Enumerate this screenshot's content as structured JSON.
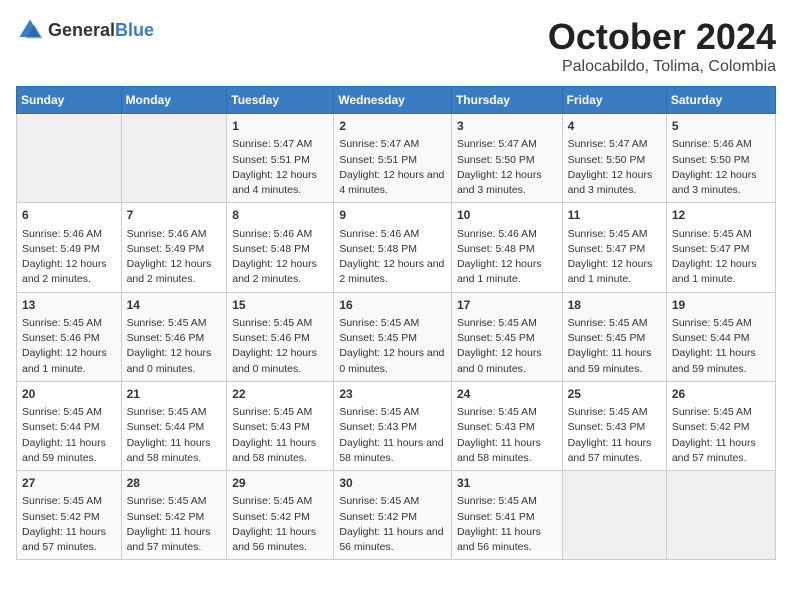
{
  "logo": {
    "text_general": "General",
    "text_blue": "Blue"
  },
  "title": "October 2024",
  "subtitle": "Palocabildo, Tolima, Colombia",
  "days_header": [
    "Sunday",
    "Monday",
    "Tuesday",
    "Wednesday",
    "Thursday",
    "Friday",
    "Saturday"
  ],
  "weeks": [
    [
      {
        "day": "",
        "info": ""
      },
      {
        "day": "",
        "info": ""
      },
      {
        "day": "1",
        "info": "Sunrise: 5:47 AM\nSunset: 5:51 PM\nDaylight: 12 hours and 4 minutes."
      },
      {
        "day": "2",
        "info": "Sunrise: 5:47 AM\nSunset: 5:51 PM\nDaylight: 12 hours and 4 minutes."
      },
      {
        "day": "3",
        "info": "Sunrise: 5:47 AM\nSunset: 5:50 PM\nDaylight: 12 hours and 3 minutes."
      },
      {
        "day": "4",
        "info": "Sunrise: 5:47 AM\nSunset: 5:50 PM\nDaylight: 12 hours and 3 minutes."
      },
      {
        "day": "5",
        "info": "Sunrise: 5:46 AM\nSunset: 5:50 PM\nDaylight: 12 hours and 3 minutes."
      }
    ],
    [
      {
        "day": "6",
        "info": "Sunrise: 5:46 AM\nSunset: 5:49 PM\nDaylight: 12 hours and 2 minutes."
      },
      {
        "day": "7",
        "info": "Sunrise: 5:46 AM\nSunset: 5:49 PM\nDaylight: 12 hours and 2 minutes."
      },
      {
        "day": "8",
        "info": "Sunrise: 5:46 AM\nSunset: 5:48 PM\nDaylight: 12 hours and 2 minutes."
      },
      {
        "day": "9",
        "info": "Sunrise: 5:46 AM\nSunset: 5:48 PM\nDaylight: 12 hours and 2 minutes."
      },
      {
        "day": "10",
        "info": "Sunrise: 5:46 AM\nSunset: 5:48 PM\nDaylight: 12 hours and 1 minute."
      },
      {
        "day": "11",
        "info": "Sunrise: 5:45 AM\nSunset: 5:47 PM\nDaylight: 12 hours and 1 minute."
      },
      {
        "day": "12",
        "info": "Sunrise: 5:45 AM\nSunset: 5:47 PM\nDaylight: 12 hours and 1 minute."
      }
    ],
    [
      {
        "day": "13",
        "info": "Sunrise: 5:45 AM\nSunset: 5:46 PM\nDaylight: 12 hours and 1 minute."
      },
      {
        "day": "14",
        "info": "Sunrise: 5:45 AM\nSunset: 5:46 PM\nDaylight: 12 hours and 0 minutes."
      },
      {
        "day": "15",
        "info": "Sunrise: 5:45 AM\nSunset: 5:46 PM\nDaylight: 12 hours and 0 minutes."
      },
      {
        "day": "16",
        "info": "Sunrise: 5:45 AM\nSunset: 5:45 PM\nDaylight: 12 hours and 0 minutes."
      },
      {
        "day": "17",
        "info": "Sunrise: 5:45 AM\nSunset: 5:45 PM\nDaylight: 12 hours and 0 minutes."
      },
      {
        "day": "18",
        "info": "Sunrise: 5:45 AM\nSunset: 5:45 PM\nDaylight: 11 hours and 59 minutes."
      },
      {
        "day": "19",
        "info": "Sunrise: 5:45 AM\nSunset: 5:44 PM\nDaylight: 11 hours and 59 minutes."
      }
    ],
    [
      {
        "day": "20",
        "info": "Sunrise: 5:45 AM\nSunset: 5:44 PM\nDaylight: 11 hours and 59 minutes."
      },
      {
        "day": "21",
        "info": "Sunrise: 5:45 AM\nSunset: 5:44 PM\nDaylight: 11 hours and 58 minutes."
      },
      {
        "day": "22",
        "info": "Sunrise: 5:45 AM\nSunset: 5:43 PM\nDaylight: 11 hours and 58 minutes."
      },
      {
        "day": "23",
        "info": "Sunrise: 5:45 AM\nSunset: 5:43 PM\nDaylight: 11 hours and 58 minutes."
      },
      {
        "day": "24",
        "info": "Sunrise: 5:45 AM\nSunset: 5:43 PM\nDaylight: 11 hours and 58 minutes."
      },
      {
        "day": "25",
        "info": "Sunrise: 5:45 AM\nSunset: 5:43 PM\nDaylight: 11 hours and 57 minutes."
      },
      {
        "day": "26",
        "info": "Sunrise: 5:45 AM\nSunset: 5:42 PM\nDaylight: 11 hours and 57 minutes."
      }
    ],
    [
      {
        "day": "27",
        "info": "Sunrise: 5:45 AM\nSunset: 5:42 PM\nDaylight: 11 hours and 57 minutes."
      },
      {
        "day": "28",
        "info": "Sunrise: 5:45 AM\nSunset: 5:42 PM\nDaylight: 11 hours and 57 minutes."
      },
      {
        "day": "29",
        "info": "Sunrise: 5:45 AM\nSunset: 5:42 PM\nDaylight: 11 hours and 56 minutes."
      },
      {
        "day": "30",
        "info": "Sunrise: 5:45 AM\nSunset: 5:42 PM\nDaylight: 11 hours and 56 minutes."
      },
      {
        "day": "31",
        "info": "Sunrise: 5:45 AM\nSunset: 5:41 PM\nDaylight: 11 hours and 56 minutes."
      },
      {
        "day": "",
        "info": ""
      },
      {
        "day": "",
        "info": ""
      }
    ]
  ]
}
